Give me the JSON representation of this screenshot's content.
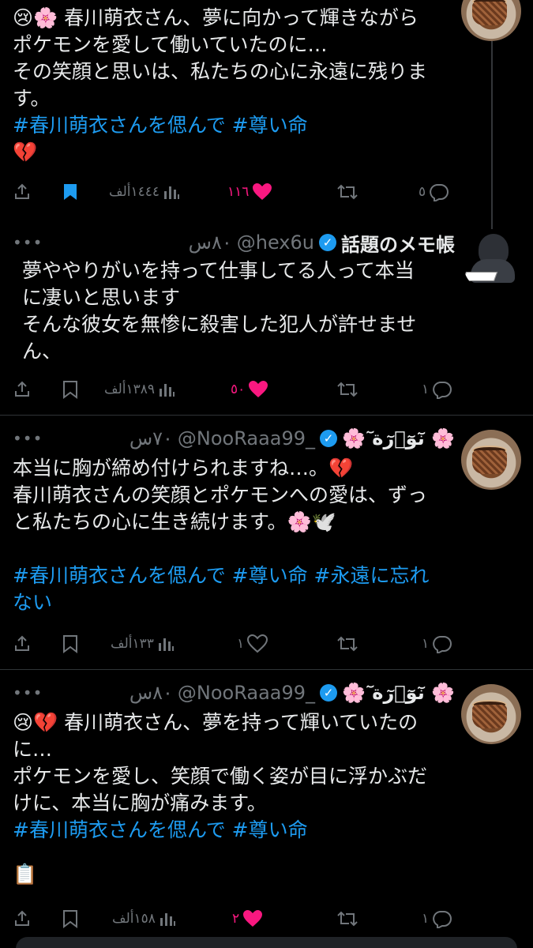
{
  "tweets": [
    {
      "body_lines": [
        "😢🌸 春川萌衣さん、夢に向かって輝きながら",
        "ポケモンを愛して働いていたのに…",
        "その笑顔と思いは、私たちの心に永遠に残りま",
        "す。"
      ],
      "hashtags": "#春川萌衣さんを偲んで #尊い命",
      "trailing": "💔",
      "views": "١٤٤٤ألف",
      "likes": "١١٦",
      "retweets": "",
      "replies": "٥"
    },
    {
      "username": "話題のメモ帳",
      "handle": "@hex6u",
      "time": "٨٠س",
      "more": "•••",
      "body_lines": [
        "夢ややりがいを持って仕事してる人って本当",
        "に凄いと思います",
        "そんな彼女を無惨に殺害した犯人が許せませ",
        "ん、"
      ],
      "views": "١٣٨٩ألف",
      "likes": "٥٠",
      "replies": "١"
    },
    {
      "username": "🌸 ٓنٓوٓ٘رٓة 🌸",
      "handle": "@NooRaaa99_",
      "time": "٧٠س",
      "more": "•••",
      "body_lines": [
        "本当に胸が締め付けられますね…。💔",
        "春川萌衣さんの笑顔とポケモンへの愛は、ずっ",
        "と私たちの心に生き続けます。🌸🕊️",
        ""
      ],
      "hashtags_lines": [
        "#春川萌衣さんを偲んで #尊い命 #永遠に忘れ",
        "ない"
      ],
      "views": "١٣٣ألف",
      "likes": "١",
      "replies": "١"
    },
    {
      "username": "🌸 ٓنٓوٓ٘رٓة 🌸",
      "handle": "@NooRaaa99_",
      "time": "٨٠س",
      "more": "•••",
      "body_lines": [
        "😢💔 春川萌衣さん、夢を持って輝いていたの",
        "に…",
        "ポケモンを愛し、笑顔で働く姿が目に浮かぶだ",
        "けに、本当に胸が痛みます。"
      ],
      "hashtags": "#春川萌衣さんを偲んで #尊い命",
      "trailing": "📋",
      "views": "١٥٨ألف",
      "likes": "٢",
      "replies": "١"
    }
  ],
  "colors": {
    "accent": "#1d9bf0",
    "like": "#f91880",
    "muted": "#71767b",
    "bg": "#000000"
  }
}
